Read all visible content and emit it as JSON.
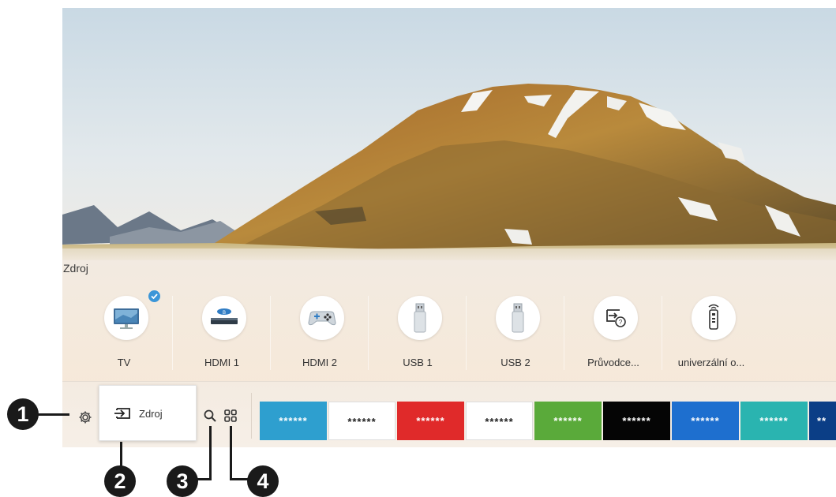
{
  "panel": {
    "title": "Zdroj",
    "sources": [
      {
        "label": "TV",
        "icon": "tv-monitor-icon",
        "selected": true
      },
      {
        "label": "HDMI 1",
        "icon": "bluray-player-icon"
      },
      {
        "label": "HDMI 2",
        "icon": "game-console-icon"
      },
      {
        "label": "USB 1",
        "icon": "usb-drive-icon"
      },
      {
        "label": "USB 2",
        "icon": "usb-drive-icon"
      },
      {
        "label": "Průvodce...",
        "icon": "connection-guide-icon"
      },
      {
        "label": "univerzální o...",
        "icon": "remote-control-icon"
      }
    ]
  },
  "bar": {
    "source_label": "Zdroj",
    "tiles": [
      {
        "text": "******",
        "bg": "#2e9fcf",
        "fg": "#ffffff"
      },
      {
        "text": "******",
        "bg": "#ffffff",
        "fg": "#222222"
      },
      {
        "text": "******",
        "bg": "#e02a2a",
        "fg": "#ffffff"
      },
      {
        "text": "******",
        "bg": "#ffffff",
        "fg": "#222222"
      },
      {
        "text": "******",
        "bg": "#5aaa3a",
        "fg": "#ffffff"
      },
      {
        "text": "******",
        "bg": "#050505",
        "fg": "#ffffff"
      },
      {
        "text": "******",
        "bg": "#1e6fcf",
        "fg": "#ffffff"
      },
      {
        "text": "******",
        "bg": "#2ab4b0",
        "fg": "#ffffff"
      },
      {
        "text": "**",
        "bg": "#0b3e86",
        "fg": "#ffffff"
      }
    ]
  },
  "callouts": [
    "1",
    "2",
    "3",
    "4"
  ]
}
